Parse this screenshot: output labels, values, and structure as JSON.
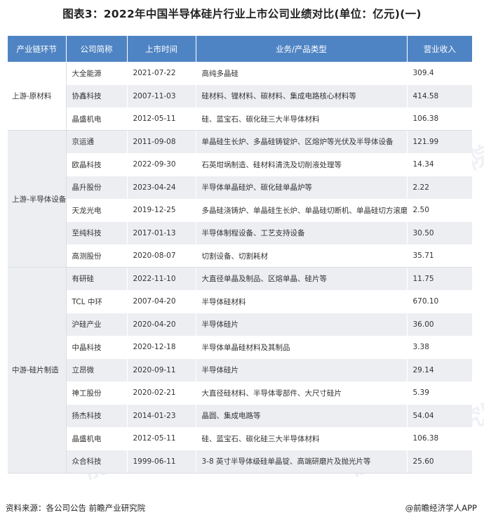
{
  "title": "图表3：2022年中国半导体硅片行业上市公司业绩对比(单位：亿元)(一)",
  "headers": [
    "产业链环节",
    "公司简称",
    "上市时间",
    "业务/产品类型",
    "营业收入"
  ],
  "groups": [
    {
      "segment": "上游-原材料",
      "rows": [
        {
          "company": "大全能源",
          "date": "2021-07-22",
          "business": "高纯多晶硅",
          "revenue": "309.4"
        },
        {
          "company": "协鑫科技",
          "date": "2007-11-03",
          "business": "硅材料、锂材料、碳材料、集成电路核心材料等",
          "revenue": "414.58"
        },
        {
          "company": "晶盛机电",
          "date": "2012-05-11",
          "business": "硅、蓝宝石、碳化硅三大半导体材料",
          "revenue": "106.38"
        }
      ]
    },
    {
      "segment": "上游-半导体设备",
      "rows": [
        {
          "company": "京运通",
          "date": "2011-09-08",
          "business": "单晶硅生长炉、多晶硅铸锭炉、区熔炉等光伏及半导体设备",
          "revenue": "121.99"
        },
        {
          "company": "欧晶科技",
          "date": "2022-09-30",
          "business": "石英坩埚制造、硅材料清洗及切削液处理等",
          "revenue": "14.34"
        },
        {
          "company": "晶升股份",
          "date": "2023-04-24",
          "business": "半导体单晶硅炉、碳化硅单晶炉等",
          "revenue": "2.22"
        },
        {
          "company": "天龙光电",
          "date": "2019-12-25",
          "business": "多晶硅浇铸炉、单晶硅生长炉、单晶硅切断机、单晶硅切方滚磨机等",
          "revenue": "2.50"
        },
        {
          "company": "至纯科技",
          "date": "2017-01-13",
          "business": "半导体制程设备、工艺支持设备",
          "revenue": "30.50"
        },
        {
          "company": "高测股份",
          "date": "2020-08-07",
          "business": "切割设备、切割耗材",
          "revenue": "35.71"
        }
      ]
    },
    {
      "segment": "中游-硅片制造",
      "rows": [
        {
          "company": "有研硅",
          "date": "2022-11-10",
          "business": "大直径单晶及制品、区熔单晶、硅片等",
          "revenue": "11.75"
        },
        {
          "company": "TCL 中环",
          "date": "2007-04-20",
          "business": "半导体硅材料",
          "revenue": "670.10"
        },
        {
          "company": "沪硅产业",
          "date": "2020-04-20",
          "business": "半导体硅片",
          "revenue": "36.00"
        },
        {
          "company": "中晶科技",
          "date": "2020-12-18",
          "business": "半导体单晶硅材料及其制品",
          "revenue": "3.38"
        },
        {
          "company": "立昂微",
          "date": "2020-09-11",
          "business": "半导体硅片",
          "revenue": "29.14"
        },
        {
          "company": "神工股份",
          "date": "2020-02-21",
          "business": "大直径硅材料、半导体零部件、大尺寸硅片",
          "revenue": "5.39"
        },
        {
          "company": "扬杰科技",
          "date": "2014-01-23",
          "business": "晶圆、集成电路等",
          "revenue": "54.04"
        },
        {
          "company": "晶盛机电",
          "date": "2012-05-11",
          "business": "硅、蓝宝石、碳化硅三大半导体材料",
          "revenue": "106.38"
        },
        {
          "company": "众合科技",
          "date": "1999-06-11",
          "business": "3-8 英寸半导体级硅单晶锭、高端研磨片及抛光片等",
          "revenue": "25.60"
        }
      ]
    }
  ],
  "footer": {
    "source": "资料来源：各公司公告 前瞻产业研究院",
    "brand": "@前瞻经济学人APP"
  },
  "watermark": "前瞻产业研究院",
  "colors": {
    "header_bg": "#4f84c4",
    "row_alt": "#eceef1"
  }
}
